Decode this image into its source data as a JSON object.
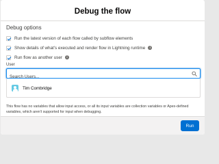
{
  "modal": {
    "title": "Debug the flow"
  },
  "debug_options": {
    "heading": "Debug options",
    "options": [
      {
        "label": "Run the latest version of each flow called by subflow elements",
        "checked": true,
        "info": false
      },
      {
        "label": "Show details of what's executed and render flow in Lightning runtime",
        "checked": true,
        "info": true
      },
      {
        "label": "Run flow as another user",
        "checked": true,
        "info": true
      }
    ]
  },
  "user_field": {
    "label": "User",
    "placeholder": "Search Users...",
    "value": "",
    "icon": "search-icon",
    "results": [
      {
        "name": "Tim Combridge",
        "icon": "user-icon"
      }
    ]
  },
  "note": "This flow has no variables that allow input access, or all its input variables are collection variables or Apex-defined variables, which aren't supported for input when debugging.",
  "footer": {
    "run_label": "Run"
  },
  "colors": {
    "brand": "#0070d2",
    "focus_border": "#1589ee",
    "user_icon": "#65cae4"
  }
}
